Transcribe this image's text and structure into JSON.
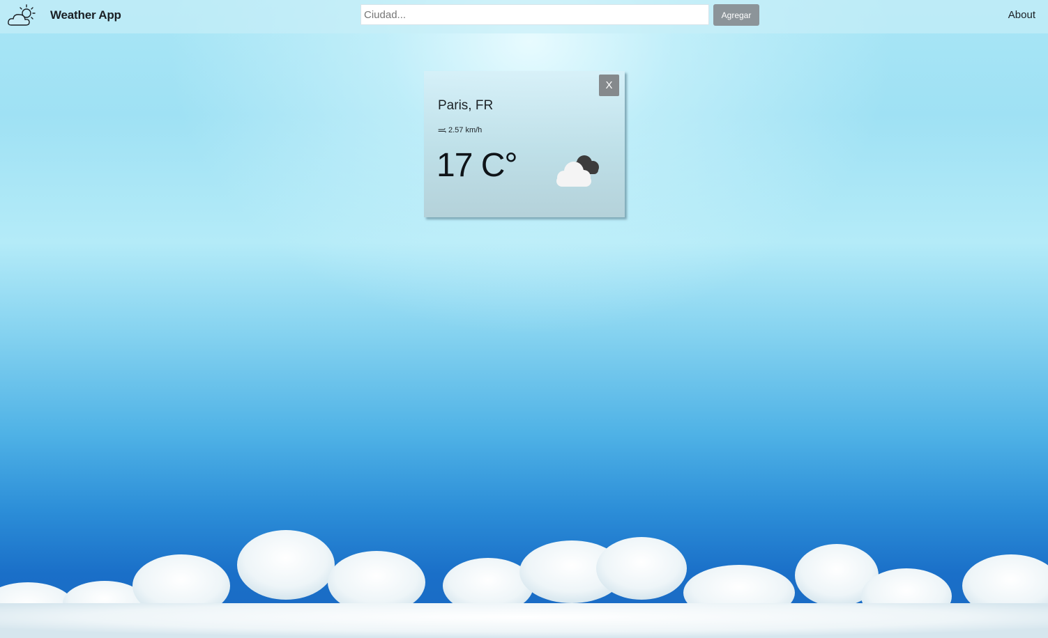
{
  "navbar": {
    "brand_icon": "sun-cloud-icon",
    "title": "Weather App",
    "search": {
      "placeholder": "Ciudad...",
      "value": ""
    },
    "add_label": "Agregar",
    "about_label": "About"
  },
  "cards": [
    {
      "close_label": "X",
      "city": "Paris, FR",
      "wind": "2.57 km/h",
      "wind_icon": "wind-icon",
      "temperature": "17 C°",
      "weather_icon": "broken-clouds-icon"
    }
  ],
  "colors": {
    "button_gray": "#8c9499",
    "close_gray": "#85898c",
    "sky_top": "#a9e6f6",
    "sky_bottom": "#1b69c2"
  }
}
